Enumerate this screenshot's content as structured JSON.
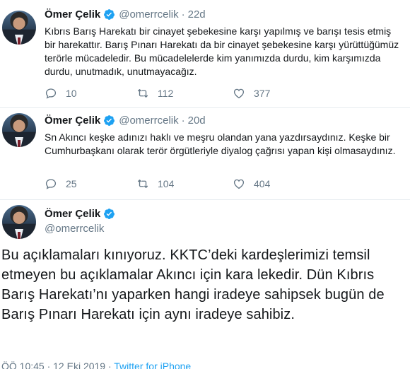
{
  "tweets": [
    {
      "name": "Ömer Çelik",
      "handle": "@omerrcelik",
      "separator": "·",
      "time": "22d",
      "text": "Kıbrıs Barış Harekatı bir cinayet şebekesine karşı yapılmış ve barışı tesis etmiş bir harekattır. Barış Pınarı Harekatı da bir cinayet şebekesine karşı yürüttüğümüz terörle mücadeledir. Bu mücadelelerde kim yanımızda durdu, kim karşımızda durdu, unutmadık, unutmayacağız.",
      "replies": "10",
      "retweets": "112",
      "likes": "377"
    },
    {
      "name": "Ömer Çelik",
      "handle": "@omerrcelik",
      "separator": "·",
      "time": "20d",
      "text": "Sn Akıncı keşke adınızı haklı ve meşru olandan yana yazdırsaydınız. Keşke bir Cumhurbaşkanı olarak terör örgütleriyle diyalog çağrısı yapan kişi olmasaydınız.",
      "replies": "25",
      "retweets": "104",
      "likes": "404"
    }
  ],
  "main_tweet": {
    "name": "Ömer Çelik",
    "handle": "@omerrcelik",
    "text": "Bu açıklamaları kınıyoruz. KKTC’deki kardeşlerimizi temsil etmeyen bu açıklamalar Akıncı için kara lekedir. Dün Kıbrıs Barış Harekatı’nı yaparken hangi iradeye sahipsek bugün de Barış Pınarı Harekatı için aynı iradeye sahibiz.",
    "timestamp": "ÖÖ 10:45 · 12 Eki 2019 · ",
    "source": "Twitter for iPhone"
  },
  "colors": {
    "text": "#14171a",
    "muted": "#657786",
    "accent": "#1da1f2",
    "divider": "#e6ecf0"
  }
}
